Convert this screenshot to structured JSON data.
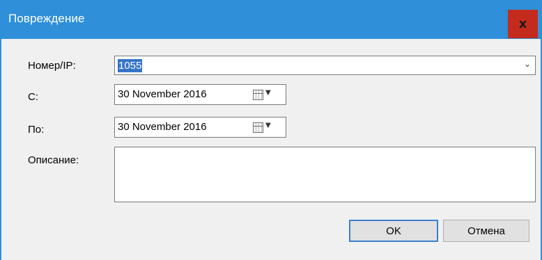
{
  "window": {
    "title": "Повреждение",
    "close_label": "x"
  },
  "form": {
    "number_label": "Номер/IP:",
    "number_value": "1055",
    "from_label": "С:",
    "from_date": "30 November 2016",
    "to_label": "По:",
    "to_date": "30 November 2016",
    "description_label": "Описание:",
    "description_value": ""
  },
  "buttons": {
    "ok_label": "OK",
    "cancel_label": "Отмена"
  },
  "icons": {
    "combo_arrow": "chevron-down-icon",
    "calendar": "calendar-icon",
    "dropdown_arrow": "dropdown-arrow-icon"
  },
  "colors": {
    "titlebar": "#2f8fd8",
    "close_button": "#c42b1c",
    "selection": "#3575c8"
  }
}
